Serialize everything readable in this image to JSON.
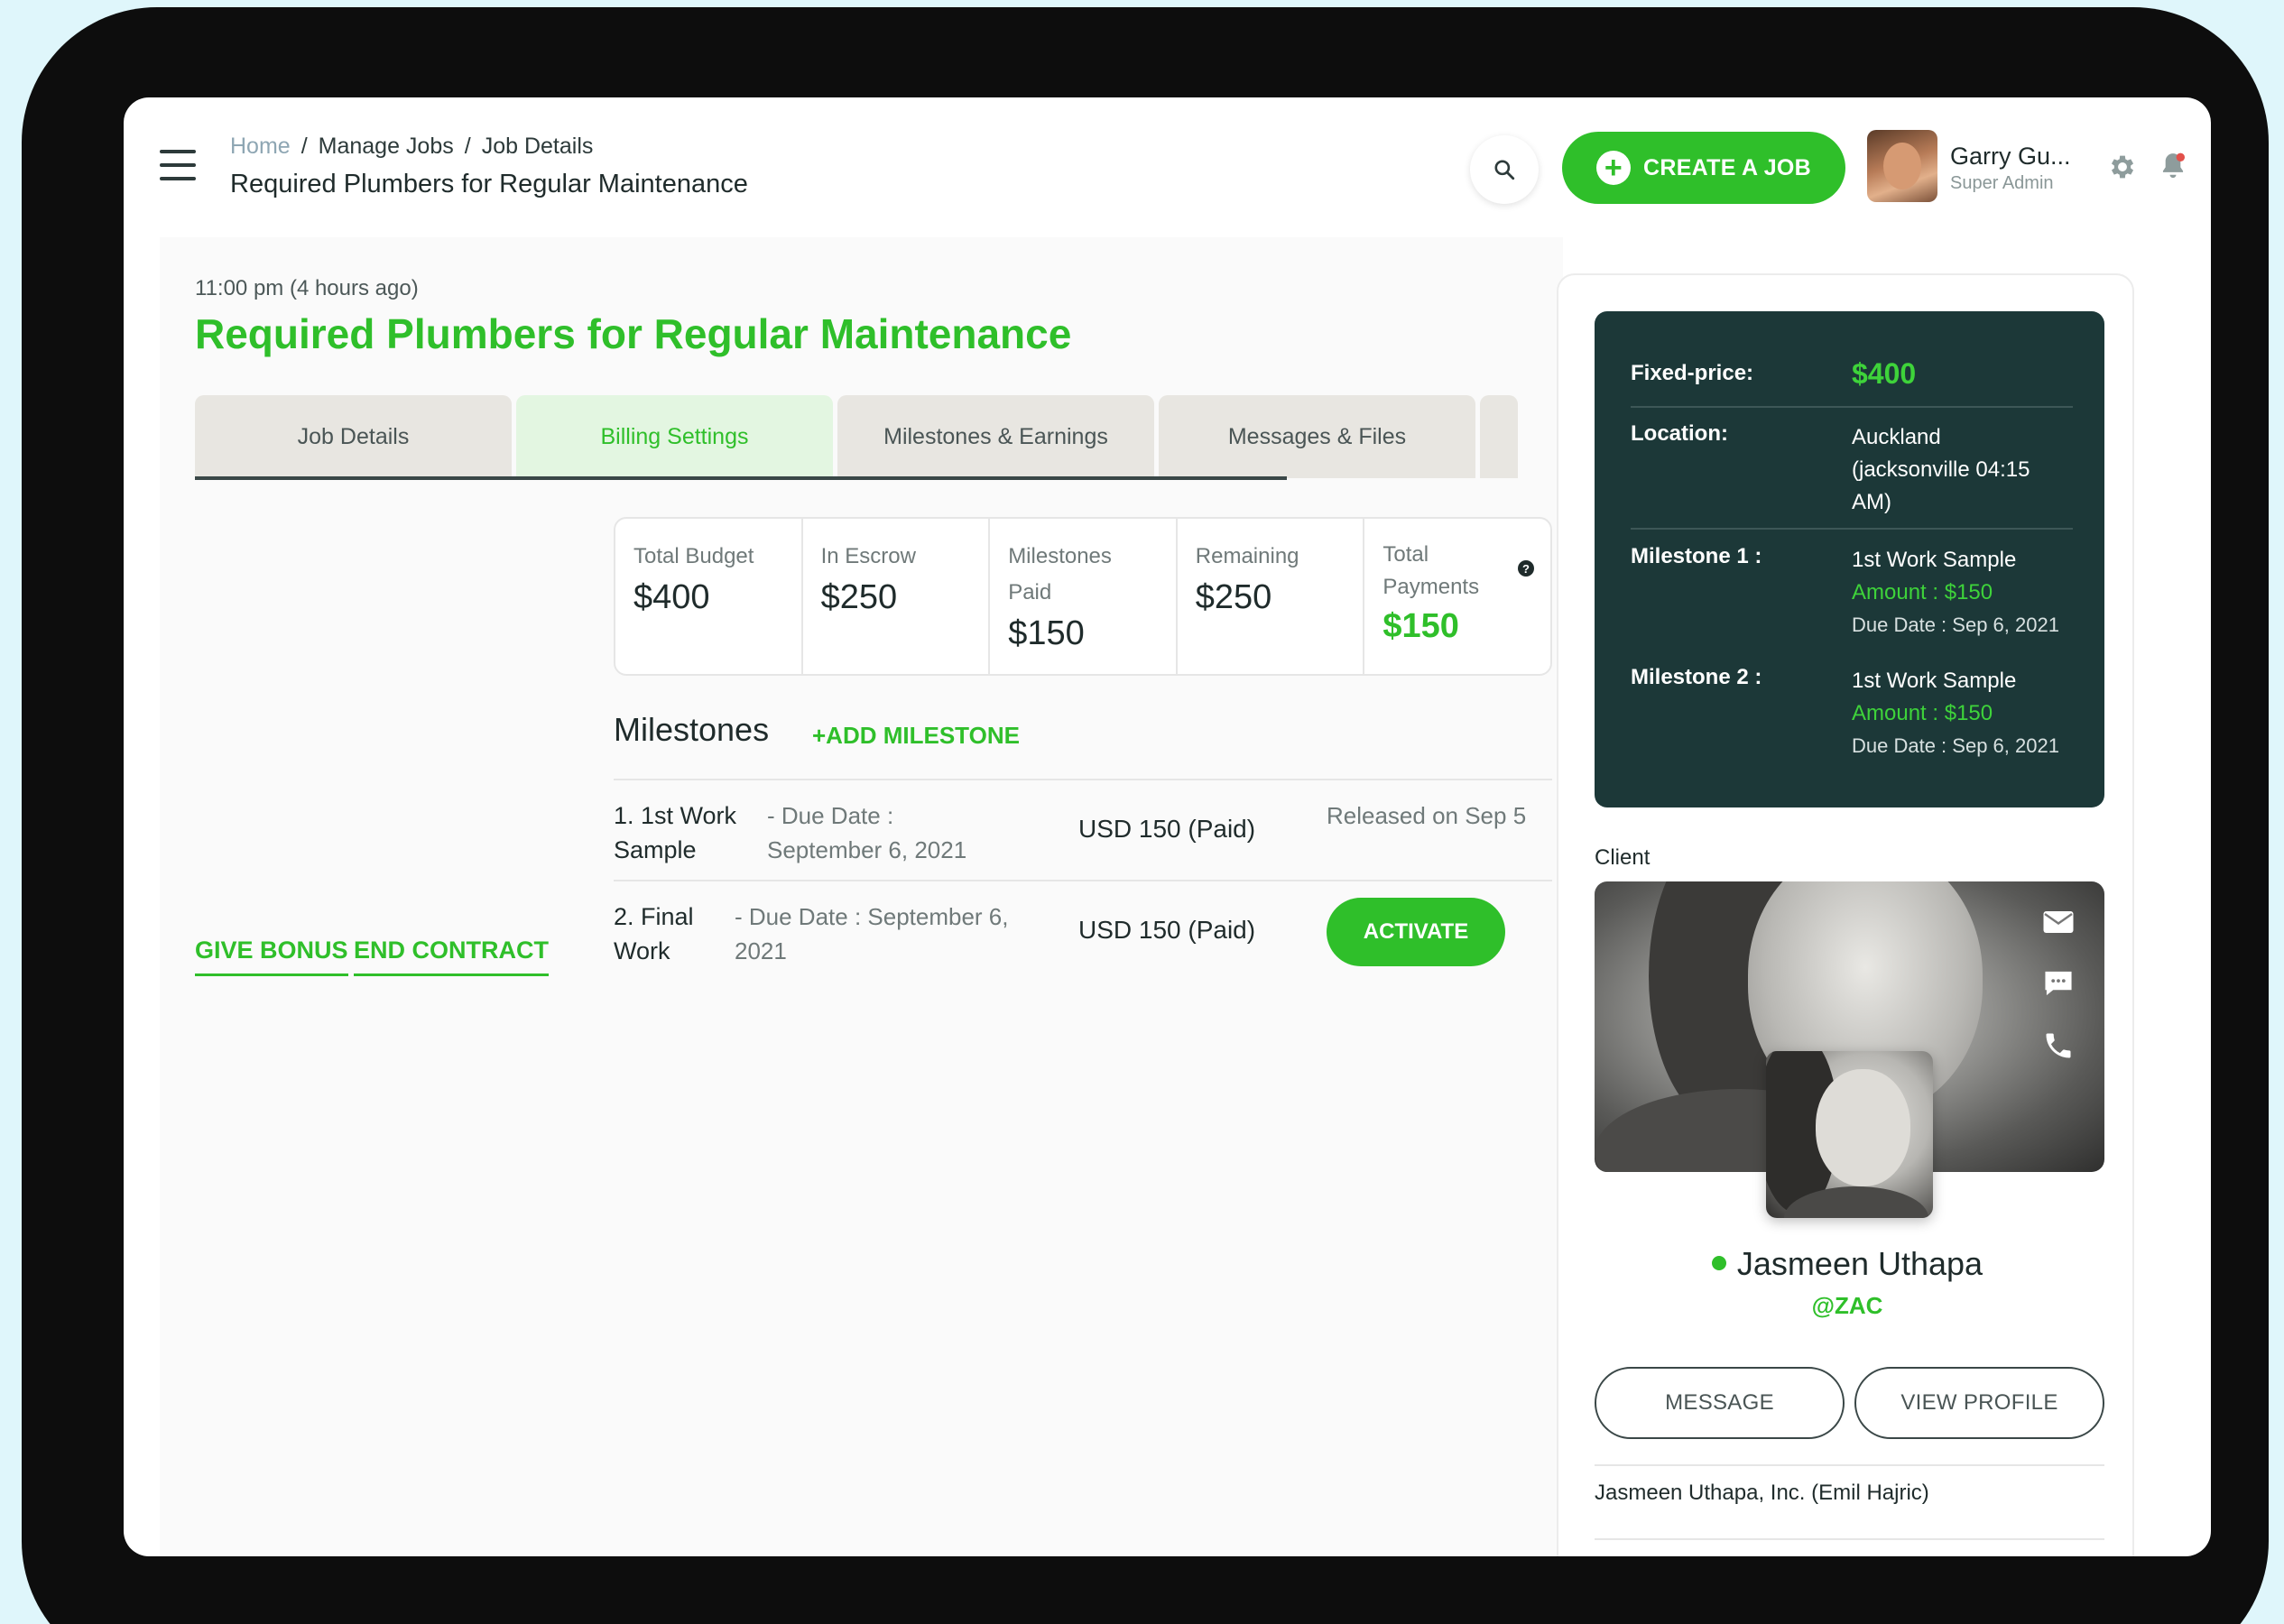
{
  "header": {
    "breadcrumb": [
      "Home",
      "Manage Jobs",
      "Job Details"
    ],
    "title": "Required Plumbers for Regular Maintenance",
    "create_label": "CREATE A JOB",
    "user_name": "Garry Gu...",
    "user_role": "Super Admin"
  },
  "job": {
    "timestamp": "11:00 pm (4 hours ago)",
    "title": "Required Plumbers for Regular Maintenance"
  },
  "tabs": [
    "Job Details",
    "Billing Settings",
    "Milestones & Earnings",
    "Messages & Files"
  ],
  "active_tab": 1,
  "stats": [
    {
      "label": "Total Budget",
      "value": "$400"
    },
    {
      "label": "In Escrow",
      "value": "$250"
    },
    {
      "label": "Milestones Paid",
      "value": "$150"
    },
    {
      "label": "Remaining",
      "value": "$250"
    },
    {
      "label": "Total Payments",
      "value": "$150"
    }
  ],
  "milestones": {
    "heading": "Milestones",
    "add_label": "+ADD MILESTONE",
    "rows": [
      {
        "name": "1. 1st Work Sample",
        "due": "- Due Date : September 6, 2021",
        "amount": "USD 150 (Paid)",
        "status": "Released on Sep 5"
      },
      {
        "name": "2. Final Work",
        "due": "- Due Date : September 6, 2021",
        "amount": "USD 150 (Paid)",
        "action": "ACTIVATE"
      }
    ]
  },
  "actions": {
    "give_bonus": "GIVE BONUS",
    "end_contract": "END CONTRACT"
  },
  "summary": {
    "fixed_label": "Fixed-price:",
    "fixed_value": "$400",
    "location_label": "Location:",
    "location_value": "Auckland (jacksonville 04:15 AM)",
    "m1_label": "Milestone 1 :",
    "m1_title": "1st Work Sample",
    "m1_amount": "Amount : $150",
    "m1_due": "Due Date : Sep 6, 2021",
    "m2_label": "Milestone 2 :",
    "m2_title": "1st Work Sample",
    "m2_amount": "Amount : $150",
    "m2_due": "Due Date : Sep 6, 2021"
  },
  "client": {
    "label": "Client",
    "name": "Jasmeen Uthapa",
    "handle": "@ZAC",
    "message_label": "MESSAGE",
    "profile_label": "VIEW PROFILE",
    "company": "Jasmeen Uthapa, Inc. (Emil Hajric)"
  },
  "colors": {
    "accent": "#2fbf2a",
    "dark_panel": "#1c3838"
  },
  "icons": [
    "menu-icon",
    "search-icon",
    "plus-icon",
    "gear-icon",
    "bell-icon",
    "help-icon",
    "mail-icon",
    "chat-icon",
    "phone-icon"
  ]
}
